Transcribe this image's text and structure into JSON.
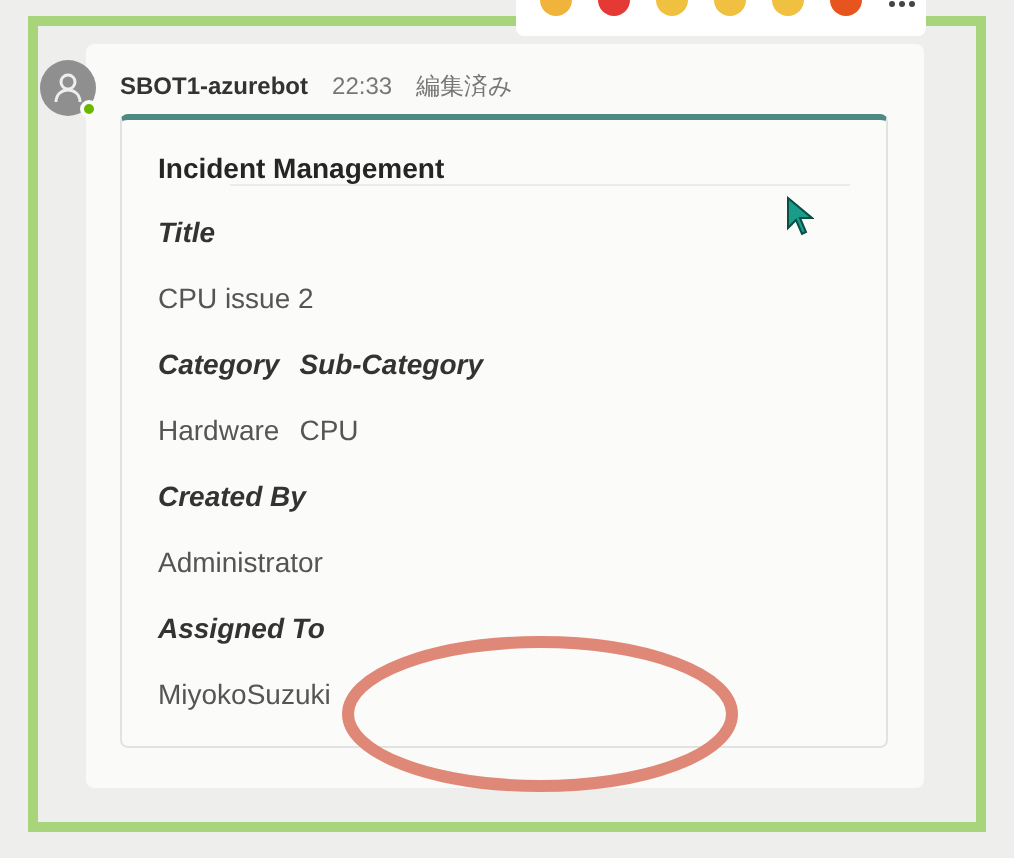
{
  "message": {
    "sender": "SBOT1-azurebot",
    "time": "22:33",
    "edited": "編集済み",
    "online": true
  },
  "card": {
    "title": "Incident Management",
    "rows": [
      {
        "kind": "label",
        "cells": [
          "Title"
        ]
      },
      {
        "kind": "value",
        "cells": [
          "CPU issue 2"
        ]
      },
      {
        "kind": "label",
        "cells": [
          "Category",
          "Sub-Category"
        ]
      },
      {
        "kind": "value",
        "cells": [
          "Hardware",
          "CPU"
        ]
      },
      {
        "kind": "label",
        "cells": [
          "Created By"
        ]
      },
      {
        "kind": "value",
        "cells": [
          "Administrator"
        ]
      },
      {
        "kind": "label",
        "cells": [
          "Assigned To"
        ]
      },
      {
        "kind": "value",
        "cells": [
          "MiyokoSuzuki"
        ]
      }
    ]
  }
}
